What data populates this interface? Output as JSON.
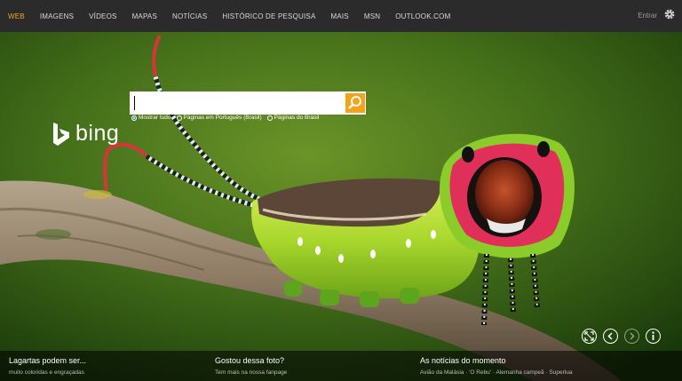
{
  "nav": {
    "items": [
      {
        "label": "WEB",
        "active": true
      },
      {
        "label": "IMAGENS"
      },
      {
        "label": "VÍDEOS"
      },
      {
        "label": "MAPAS"
      },
      {
        "label": "NOTÍCIAS"
      },
      {
        "label": "HISTÓRICO DE PESQUISA"
      },
      {
        "label": "MAIS"
      },
      {
        "label": "MSN"
      },
      {
        "label": "OUTLOOK.COM"
      }
    ],
    "signin": "Entrar",
    "settings_icon": "gear-icon"
  },
  "logo": {
    "text": "bing"
  },
  "search": {
    "value": "",
    "placeholder": ""
  },
  "search_options": [
    {
      "label": "Mostrar tudo",
      "selected": true
    },
    {
      "label": "Páginas em Português (Brasil)",
      "selected": false
    },
    {
      "label": "Páginas do Brasil",
      "selected": false
    }
  ],
  "controls": {
    "icons": [
      "fullscreen-icon",
      "previous-icon",
      "next-icon",
      "info-icon"
    ]
  },
  "footer": {
    "col1": {
      "title": "Lagartas podem ser...",
      "sub": "muito coloridas e engraçadas"
    },
    "col2": {
      "title": "Gostou dessa foto?",
      "sub": "Tem mais na nossa fanpage"
    },
    "col3": {
      "title": "As notícias do momento",
      "sub": "Avião da Malásia · 'O Rebu' · Alemanha campeã · Superlua"
    }
  },
  "colors": {
    "accent": "#f5a623",
    "search_button": "#f5a31a",
    "topbar": "#2b2b2b"
  }
}
